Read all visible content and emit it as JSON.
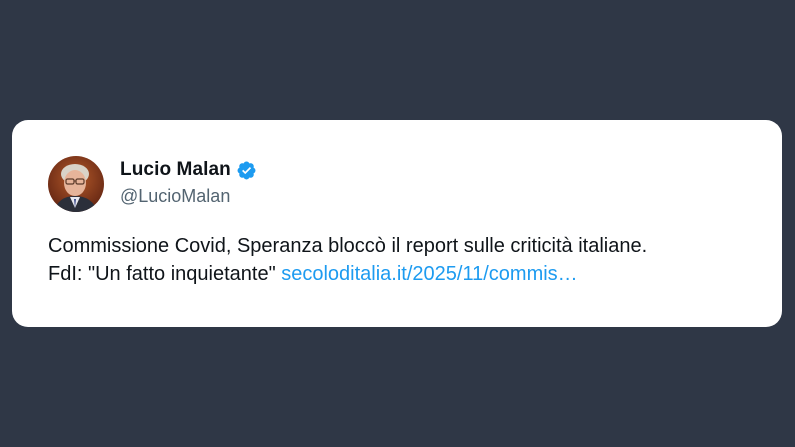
{
  "tweet": {
    "author": {
      "display_name": "Lucio Malan",
      "handle": "@LucioMalan",
      "verified": true,
      "avatar_icon": "profile-photo"
    },
    "text_line1": "Commissione Covid, Speranza bloccò il report sulle criticità italiane.",
    "text_line2_prefix": "FdI: \"Un fatto inquietante\"",
    "link_text": "secoloditalia.it/2025/11/commis…"
  },
  "colors": {
    "background": "#2f3746",
    "card": "#ffffff",
    "link": "#1d9bf0",
    "verified_badge": "#1d9bf0",
    "text_primary": "#0f1419",
    "text_secondary": "#536471"
  }
}
